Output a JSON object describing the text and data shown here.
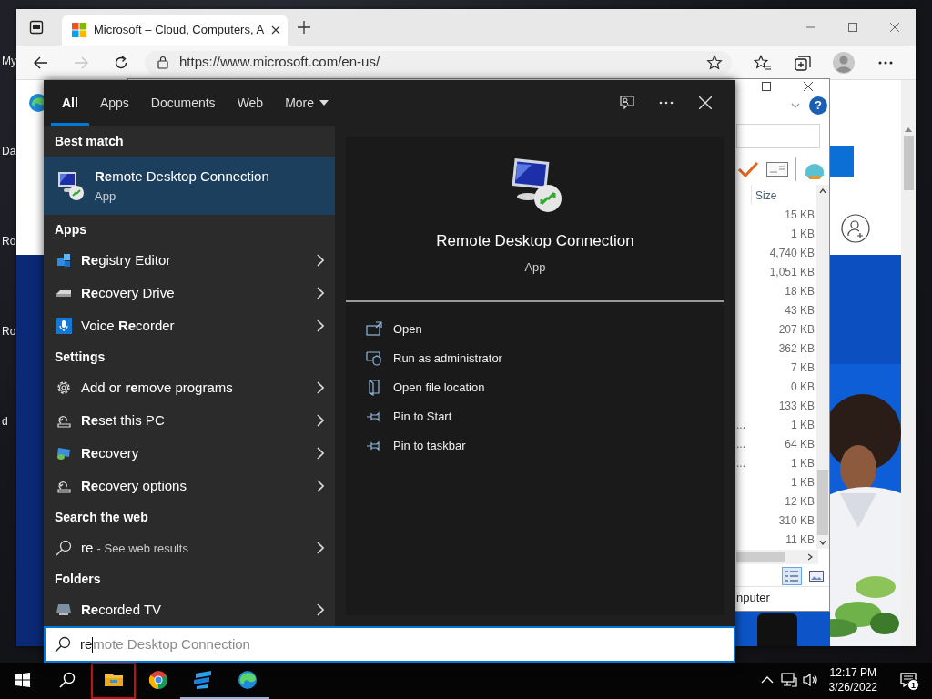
{
  "desktop_icons": [
    {
      "label": "My"
    },
    {
      "label": "Da"
    },
    {
      "label": "Ro"
    },
    {
      "label": "Ro"
    },
    {
      "label": "d"
    }
  ],
  "browser": {
    "tab_title": "Microsoft – Cloud, Computers, A",
    "address": "https://www.microsoft.com/en-us/"
  },
  "explorer": {
    "help": "?",
    "size_header": "Size",
    "rows": [
      {
        "size": "15 KB"
      },
      {
        "size": "1 KB"
      },
      {
        "size": "4,740 KB"
      },
      {
        "size": "1,051 KB"
      },
      {
        "size": "18 KB"
      },
      {
        "size": "43 KB"
      },
      {
        "size": "207 KB"
      },
      {
        "size": "362 KB"
      },
      {
        "size": "7 KB"
      },
      {
        "size": "0 KB"
      },
      {
        "size": "133 KB"
      },
      {
        "column_1": "...",
        "size": "1 KB"
      },
      {
        "column_1": "...",
        "size": "64 KB"
      },
      {
        "column_1": "...",
        "size": "1 KB"
      },
      {
        "size": "1 KB"
      },
      {
        "size": "12 KB"
      },
      {
        "size": "310 KB"
      },
      {
        "size": "11 KB"
      }
    ],
    "status": "nputer"
  },
  "search": {
    "tabs": [
      {
        "label": "All",
        "selected": true
      },
      {
        "label": "Apps",
        "selected": false
      },
      {
        "label": "Documents",
        "selected": false
      },
      {
        "label": "Web",
        "selected": false
      },
      {
        "label": "More",
        "selected": false,
        "kind": "dropdown"
      }
    ],
    "sections": [
      {
        "heading": "Best match",
        "results": [
          {
            "kind": "rdc",
            "title": "**Re**mote Desktop Connection",
            "subtitle": "App",
            "selected": true
          }
        ]
      },
      {
        "heading": "Apps",
        "results": [
          {
            "kind": "registry",
            "title": "**Re**gistry Editor",
            "selected": false
          },
          {
            "kind": "drive",
            "title": "**Re**covery Drive",
            "selected": false
          },
          {
            "kind": "mic",
            "title": "Voice **Re**corder",
            "selected": false
          }
        ]
      },
      {
        "heading": "Settings",
        "results": [
          {
            "kind": "gear",
            "title": "Add or **re**move programs",
            "selected": false
          },
          {
            "kind": "reset",
            "title": "**Re**set this PC",
            "selected": false
          },
          {
            "kind": "recovery",
            "title": "**Re**covery",
            "selected": false
          },
          {
            "kind": "reset",
            "title": "**Re**covery options",
            "selected": false
          }
        ]
      },
      {
        "heading": "Search the web",
        "results": [
          {
            "kind": "web",
            "title": "re",
            "hint": "- See web results",
            "selected": false
          }
        ]
      },
      {
        "heading": "Folders",
        "results": [
          {
            "kind": "tv",
            "title": "**Re**corded TV",
            "selected": false
          }
        ]
      }
    ],
    "preview": {
      "title": "Remote Desktop Connection",
      "subtitle": "App",
      "actions": [
        {
          "kind": "open",
          "label": "Open"
        },
        {
          "kind": "admin",
          "label": "Run as administrator"
        },
        {
          "kind": "location",
          "label": "Open file location"
        },
        {
          "kind": "pin",
          "label": "Pin to Start"
        },
        {
          "kind": "pin",
          "label": "Pin to taskbar"
        }
      ]
    },
    "query": "re",
    "suggestion": "mote Desktop Connection"
  },
  "taskbar": {
    "apps": [
      {
        "kind": "explorer",
        "running": false,
        "highlighted": true
      },
      {
        "kind": "chrome",
        "running": false,
        "highlighted": false
      },
      {
        "kind": "app",
        "running": true,
        "highlighted": false
      },
      {
        "kind": "edge",
        "running": true,
        "highlighted": false
      }
    ],
    "time": "12:17 PM",
    "date": "3/26/2022",
    "notification_count": "1"
  }
}
